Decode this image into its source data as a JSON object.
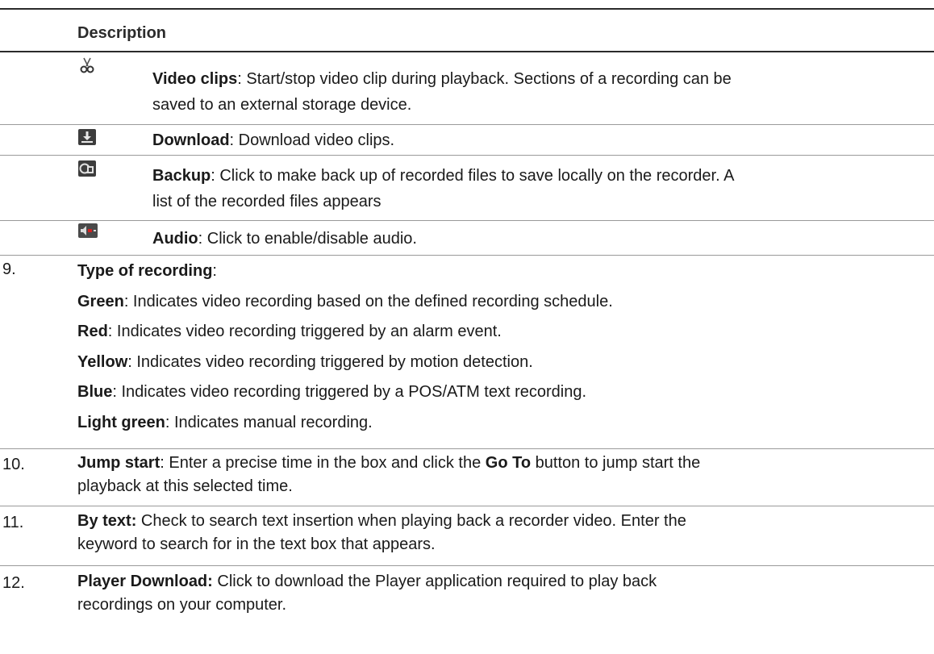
{
  "table": {
    "header": "Description",
    "rows": [
      {
        "icon": "scissors-icon",
        "term": "Video clips",
        "text": ": Start/stop video clip during playback. Sections of a recording can be",
        "text2": "saved to an external storage device."
      },
      {
        "icon": "download-icon",
        "term": "Download",
        "text": ": Download video clips."
      },
      {
        "icon": "backup-icon",
        "term": "Backup",
        "text": ": Click to make back up of recorded files to save locally on the recorder. A",
        "text2": "list of the recorded files appears"
      },
      {
        "icon": "audio-mute-icon",
        "term": "Audio",
        "text": ": Click to enable/disable audio."
      }
    ]
  },
  "items": [
    {
      "number": "9.",
      "title": "Type of recording",
      "title_suffix": ":",
      "lines": [
        {
          "term": "Green",
          "text": ": Indicates video recording based on the defined recording schedule."
        },
        {
          "term": "Red",
          "text": ": Indicates video recording triggered by an alarm event."
        },
        {
          "term": "Yellow",
          "text": ": Indicates video recording triggered by motion detection."
        },
        {
          "term": "Blue",
          "text": ": Indicates video recording triggered by a POS/ATM text recording."
        },
        {
          "term": "Light green",
          "text": ": Indicates manual recording."
        }
      ]
    },
    {
      "number": "10.",
      "title": "Jump start",
      "text_a": ": Enter a precise time in the box and click the ",
      "bold_mid": "Go To",
      "text_b": " button to jump start the",
      "line2": "playback at this selected time."
    },
    {
      "number": "11.",
      "title": "By text:",
      "text": " Check to search text insertion when playing back a recorder video. Enter the",
      "line2": "keyword to search for in the text box that appears."
    },
    {
      "number": "12.",
      "title": "Player Download:",
      "text": " Click to download the Player application required to play back",
      "line2": "recordings on your computer."
    }
  ]
}
